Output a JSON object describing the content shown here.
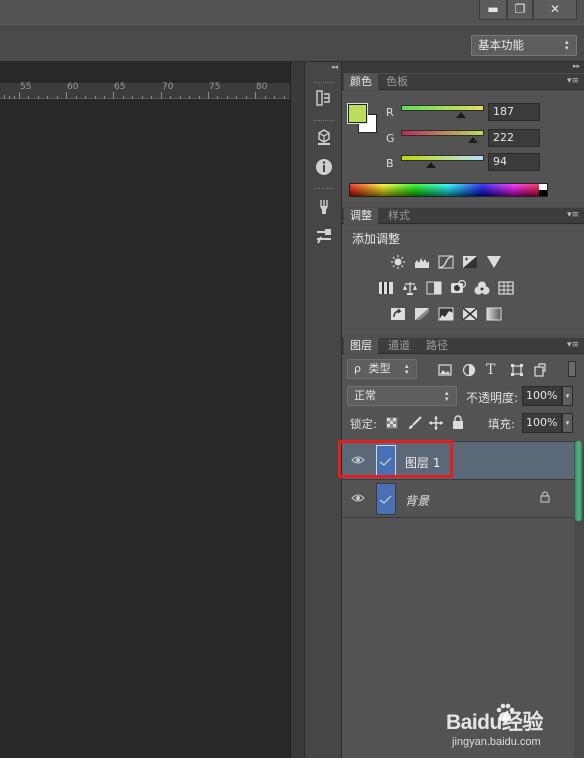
{
  "workspace": {
    "label": "基本功能"
  },
  "window_buttons": {
    "minimize": "▬",
    "restore": "❐",
    "close": "✕"
  },
  "ruler": {
    "ticks": [
      "55",
      "60",
      "65",
      "70",
      "75",
      "80"
    ]
  },
  "color_panel": {
    "tabs": [
      "颜色",
      "色板"
    ],
    "channels": [
      {
        "name": "R",
        "value": "187",
        "level": 0.733,
        "gradient": [
          "#5fde5e",
          "#e7dc5e"
        ]
      },
      {
        "name": "G",
        "value": "222",
        "level": 0.871,
        "gradient": [
          "#bb2a5e",
          "#bbde5e"
        ]
      },
      {
        "name": "B",
        "value": "94",
        "level": 0.369,
        "gradient": [
          "#bbde00",
          "#bbdeff"
        ]
      }
    ],
    "foreground": "#bbde5e",
    "background": "#ffffff"
  },
  "adjustments_panel": {
    "tabs": [
      "调整",
      "样式"
    ],
    "heading": "添加调整",
    "rows": [
      [
        "brightness-contrast-icon",
        "levels-icon",
        "curves-icon",
        "exposure-icon",
        "vibrance-icon"
      ],
      [
        "hue-saturation-icon",
        "color-balance-icon",
        "black-white-icon",
        "photo-filter-icon",
        "channel-mixer-icon",
        "color-lookup-icon"
      ],
      [
        "invert-icon",
        "posterize-icon",
        "threshold-icon",
        "selective-color-icon",
        "gradient-map-icon"
      ]
    ]
  },
  "layers_panel": {
    "tabs": [
      "图层",
      "通道",
      "路径"
    ],
    "filter_label": "类型",
    "filter_prefix": "ρ",
    "blend_mode": "正常",
    "opacity_label": "不透明度:",
    "opacity_value": "100%",
    "lock_label": "锁定:",
    "fill_label": "填充:",
    "fill_value": "100%",
    "layers": [
      {
        "name": "图层 1",
        "selected": true,
        "locked": false
      },
      {
        "name": "背景",
        "selected": false,
        "locked": true
      }
    ]
  },
  "panel_menu_glyph": "▾≡",
  "collapse_glyph": "◂◂",
  "expand_glyph": "▸▸",
  "watermark": {
    "brand": "Baidu经验",
    "url": "jingyan.baidu.com"
  },
  "colors": {
    "highlight_box": "#e02020",
    "selected_row": "#5a6878"
  }
}
